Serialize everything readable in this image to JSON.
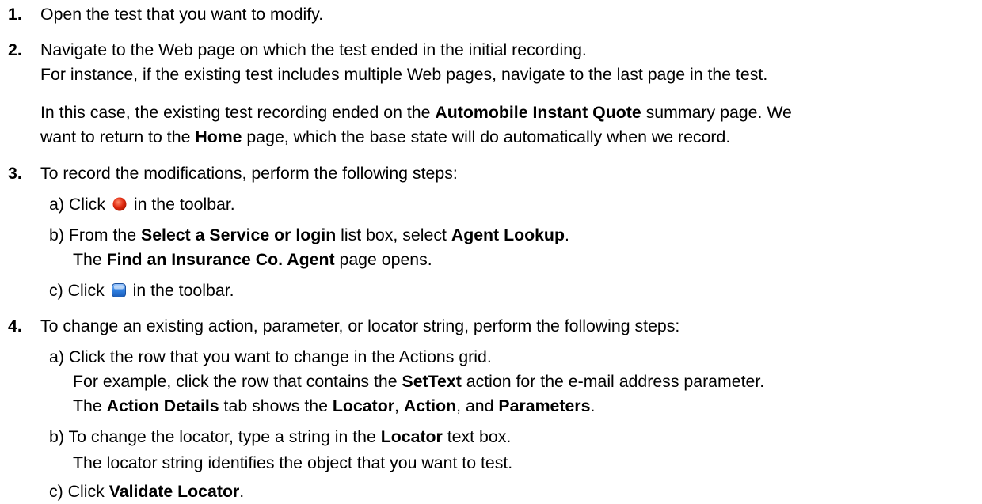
{
  "steps": [
    {
      "num": "1.",
      "text": "Open the test that you want to modify."
    },
    {
      "num": "2.",
      "line1": "Navigate to the Web page on which the test ended in the initial recording.",
      "line2": "For instance, if the existing test includes multiple Web pages, navigate to the last page in the test.",
      "para_a": "In this case, the existing test recording ended on the ",
      "para_b": "Automobile Instant Quote",
      "para_c": " summary page. We",
      "para_d": "want to return to the ",
      "para_e": "Home",
      "para_f": " page, which the base state will do automatically when we record."
    },
    {
      "num": "3.",
      "text": "To record the modifications, perform the following steps:",
      "substeps": [
        {
          "label": "a)",
          "pre": "Click ",
          "icon": "record-icon",
          "post": " in the toolbar."
        },
        {
          "label": "b)",
          "pre": "From the ",
          "b1": "Select a Service or login",
          "mid": " list box, select ",
          "b2": "Agent Lookup",
          "end": ".",
          "line2_pre": "The ",
          "line2_b": "Find an Insurance Co. Agent",
          "line2_post": " page opens."
        },
        {
          "label": "c)",
          "pre": "Click ",
          "icon": "stop-icon",
          "post": " in the toolbar."
        }
      ]
    },
    {
      "num": "4.",
      "text": "To change an existing action, parameter, or locator string, perform the following steps:",
      "substeps": [
        {
          "label": "a)",
          "text": "Click the row that you want to change in the Actions grid.",
          "line2_pre": "For example, click the row that contains the ",
          "line2_b": "SetText",
          "line2_post": " action for the e-mail address parameter.",
          "line3_a": "The ",
          "line3_b": "Action Details",
          "line3_c": " tab shows the ",
          "line3_d": "Locator",
          "line3_e": ", ",
          "line3_f": "Action",
          "line3_g": ", and ",
          "line3_h": "Parameters",
          "line3_i": "."
        },
        {
          "label": "b)",
          "pre": "To change the locator, type a string in the ",
          "b1": "Locator",
          "post": " text box.",
          "line2": "The locator string identifies the object that you want to test."
        },
        {
          "label": "c)",
          "pre": "Click ",
          "b1": "Validate Locator",
          "post": "."
        }
      ]
    }
  ],
  "colors": {
    "record": "#e02a10",
    "stop": "#2f7fe0"
  }
}
